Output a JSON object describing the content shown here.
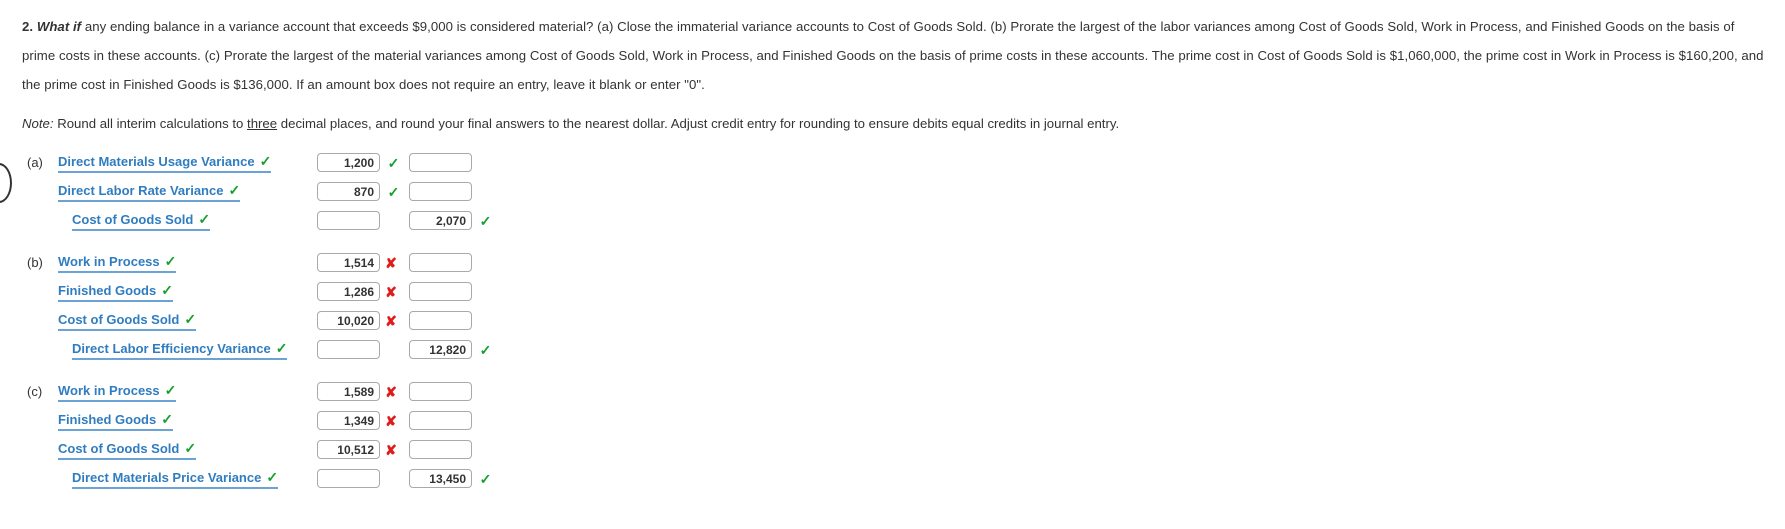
{
  "question": {
    "number": "2.",
    "whatif": "What if",
    "body_1": " any ending balance in a variance account that exceeds $9,000 is considered material? (a) Close the immaterial variance accounts to Cost of Goods Sold. (b) Prorate the largest of the labor variances among Cost of Goods Sold, Work in Process, and Finished Goods on the basis of prime costs in these accounts. (c) Prorate the largest of the material variances among Cost of Goods Sold, Work in Process, and Finished Goods on the basis of prime costs in these accounts. The prime cost in Cost of Goods Sold is $1,060,000, the prime cost in Work in Process is $160,200, and the prime cost in Finished Goods is $136,000. If an amount box does not require an entry, leave it blank or enter \"0\"."
  },
  "note": {
    "label": "Note:",
    "text_1": " Round all interim calculations to ",
    "underlined": "three",
    "text_2": " decimal places, and round your final answers to the nearest dollar. Adjust credit entry for rounding to ensure debits equal credits in journal entry."
  },
  "colors": {
    "link": "#2f7dc0",
    "underline": "#6ba3d6",
    "correct": "#15a02d",
    "incorrect": "#e01b1b",
    "box_border": "#a9a9a9",
    "text": "#333333"
  },
  "icons": {
    "check": "✓",
    "cross": "✘"
  },
  "groups": [
    {
      "letter": "(a)",
      "rows": [
        {
          "account": "Direct Materials Usage Variance",
          "account_mark": "correct",
          "indent": false,
          "debit": "1,200",
          "debit_mark": "correct",
          "credit": "",
          "credit_mark": "none"
        },
        {
          "account": "Direct Labor Rate Variance",
          "account_mark": "correct",
          "indent": false,
          "debit": "870",
          "debit_mark": "correct",
          "credit": "",
          "credit_mark": "none"
        },
        {
          "account": "Cost of Goods Sold",
          "account_mark": "correct",
          "indent": true,
          "debit": "",
          "debit_mark": "none",
          "credit": "2,070",
          "credit_mark": "correct"
        }
      ]
    },
    {
      "letter": "(b)",
      "rows": [
        {
          "account": "Work in Process",
          "account_mark": "correct",
          "indent": false,
          "debit": "1,514",
          "debit_mark": "incorrect",
          "credit": "",
          "credit_mark": "none"
        },
        {
          "account": "Finished Goods",
          "account_mark": "correct",
          "indent": false,
          "debit": "1,286",
          "debit_mark": "incorrect",
          "credit": "",
          "credit_mark": "none"
        },
        {
          "account": "Cost of Goods Sold",
          "account_mark": "correct",
          "indent": false,
          "debit": "10,020",
          "debit_mark": "incorrect",
          "credit": "",
          "credit_mark": "none"
        },
        {
          "account": "Direct Labor Efficiency Variance",
          "account_mark": "correct",
          "indent": true,
          "debit": "",
          "debit_mark": "none",
          "credit": "12,820",
          "credit_mark": "correct"
        }
      ]
    },
    {
      "letter": "(c)",
      "rows": [
        {
          "account": "Work in Process",
          "account_mark": "correct",
          "indent": false,
          "debit": "1,589",
          "debit_mark": "incorrect",
          "credit": "",
          "credit_mark": "none"
        },
        {
          "account": "Finished Goods",
          "account_mark": "correct",
          "indent": false,
          "debit": "1,349",
          "debit_mark": "incorrect",
          "credit": "",
          "credit_mark": "none"
        },
        {
          "account": "Cost of Goods Sold",
          "account_mark": "correct",
          "indent": false,
          "debit": "10,512",
          "debit_mark": "incorrect",
          "credit": "",
          "credit_mark": "none"
        },
        {
          "account": "Direct Materials Price Variance",
          "account_mark": "correct",
          "indent": true,
          "debit": "",
          "debit_mark": "none",
          "credit": "13,450",
          "credit_mark": "correct"
        }
      ]
    }
  ]
}
